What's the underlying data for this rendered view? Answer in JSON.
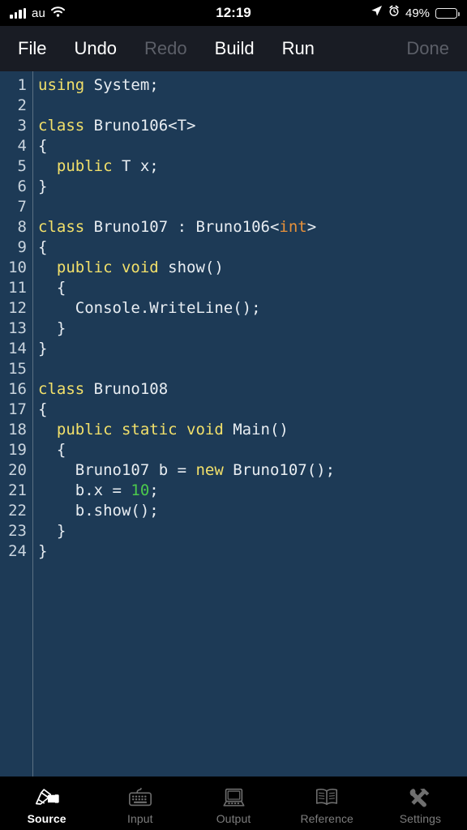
{
  "status_bar": {
    "carrier": "au",
    "time": "12:19",
    "battery_percent": "49%",
    "battery_level": 49,
    "icons": [
      "signal-bars-icon",
      "wifi-icon",
      "location-arrow-icon",
      "alarm-clock-icon",
      "battery-icon"
    ]
  },
  "toolbar": {
    "file_label": "File",
    "undo_label": "Undo",
    "redo_label": "Redo",
    "build_label": "Build",
    "run_label": "Run",
    "done_label": "Done"
  },
  "editor": {
    "line_numbers": [
      "1",
      "2",
      "3",
      "4",
      "5",
      "6",
      "7",
      "8",
      "9",
      "10",
      "11",
      "12",
      "13",
      "14",
      "15",
      "16",
      "17",
      "18",
      "19",
      "20",
      "21",
      "22",
      "23",
      "24"
    ],
    "lines": [
      [
        {
          "t": "using",
          "c": "kw"
        },
        {
          "t": " System;",
          "c": "pln"
        }
      ],
      [],
      [
        {
          "t": "class",
          "c": "kw"
        },
        {
          "t": " Bruno106<T>",
          "c": "pln"
        }
      ],
      [
        {
          "t": "{",
          "c": "pln"
        }
      ],
      [
        {
          "t": "  ",
          "c": "pln"
        },
        {
          "t": "public",
          "c": "kw"
        },
        {
          "t": " T x;",
          "c": "pln"
        }
      ],
      [
        {
          "t": "}",
          "c": "pln"
        }
      ],
      [],
      [
        {
          "t": "class",
          "c": "kw"
        },
        {
          "t": " Bruno107 : Bruno106<",
          "c": "pln"
        },
        {
          "t": "int",
          "c": "typ"
        },
        {
          "t": ">",
          "c": "pln"
        }
      ],
      [
        {
          "t": "{",
          "c": "pln"
        }
      ],
      [
        {
          "t": "  ",
          "c": "pln"
        },
        {
          "t": "public void",
          "c": "kw"
        },
        {
          "t": " show()",
          "c": "pln"
        }
      ],
      [
        {
          "t": "  {",
          "c": "pln"
        }
      ],
      [
        {
          "t": "    Console.WriteLine();",
          "c": "pln"
        }
      ],
      [
        {
          "t": "  }",
          "c": "pln"
        }
      ],
      [
        {
          "t": "}",
          "c": "pln"
        }
      ],
      [],
      [
        {
          "t": "class",
          "c": "kw"
        },
        {
          "t": " Bruno108",
          "c": "pln"
        }
      ],
      [
        {
          "t": "{",
          "c": "pln"
        }
      ],
      [
        {
          "t": "  ",
          "c": "pln"
        },
        {
          "t": "public static void",
          "c": "kw"
        },
        {
          "t": " Main()",
          "c": "pln"
        }
      ],
      [
        {
          "t": "  {",
          "c": "pln"
        }
      ],
      [
        {
          "t": "    Bruno107 b = ",
          "c": "pln"
        },
        {
          "t": "new",
          "c": "kw"
        },
        {
          "t": " Bruno107();",
          "c": "pln"
        }
      ],
      [
        {
          "t": "    b.x = ",
          "c": "pln"
        },
        {
          "t": "10",
          "c": "num"
        },
        {
          "t": ";",
          "c": "pln"
        }
      ],
      [
        {
          "t": "    b.show();",
          "c": "pln"
        }
      ],
      [
        {
          "t": "  }",
          "c": "pln"
        }
      ],
      [
        {
          "t": "}",
          "c": "pln"
        }
      ]
    ],
    "colors": {
      "background": "#1d3a56",
      "keyword": "#f2e06a",
      "type": "#e8913a",
      "number": "#4cc94c",
      "plain": "#e8edf2",
      "gutter_text": "#c9d4de"
    }
  },
  "tabbar": {
    "items": [
      {
        "label": "Source",
        "icon": "hand-writing-pen-icon",
        "active": true
      },
      {
        "label": "Input",
        "icon": "keyboard-icon",
        "active": false
      },
      {
        "label": "Output",
        "icon": "computer-monitor-icon",
        "active": false
      },
      {
        "label": "Reference",
        "icon": "open-book-icon",
        "active": false
      },
      {
        "label": "Settings",
        "icon": "hammer-wrench-icon",
        "active": false
      }
    ]
  }
}
